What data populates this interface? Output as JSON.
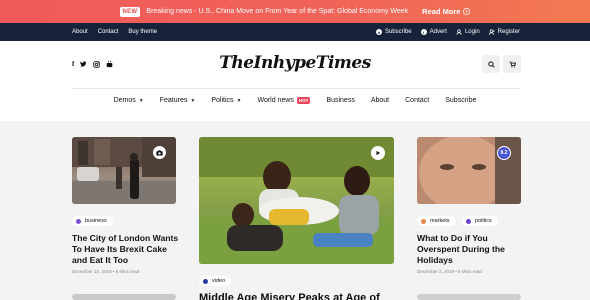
{
  "breaking": {
    "badge": "NEW",
    "text": "Breaking news - U.S., China Move on From Year of the Spat: Global Economy Week",
    "more": "Read More",
    "arrow_icon": "arrow-right-icon"
  },
  "topbar": {
    "links": [
      "About",
      "Contact",
      "Buy theme"
    ],
    "actions": [
      {
        "label": "Subscribe",
        "icon": "bell-icon"
      },
      {
        "label": "Advert",
        "icon": "info-icon"
      },
      {
        "label": "Login",
        "icon": "user-icon"
      },
      {
        "label": "Register",
        "icon": "user-plus-icon"
      }
    ]
  },
  "header": {
    "logo": "TheInhypeTimes",
    "social_icons": [
      "facebook-icon",
      "twitter-icon",
      "instagram-icon",
      "youtube-icon"
    ]
  },
  "nav": {
    "items": [
      {
        "label": "Demos",
        "dropdown": true
      },
      {
        "label": "Features",
        "dropdown": true
      },
      {
        "label": "Politics",
        "dropdown": true
      },
      {
        "label": "World news",
        "badge": "HOT"
      },
      {
        "label": "Business"
      },
      {
        "label": "About"
      },
      {
        "label": "Contact"
      },
      {
        "label": "Subscribe"
      }
    ]
  },
  "articles": {
    "left": {
      "tag": "business",
      "tag_color": "#7b4fd6",
      "title": "The City of London Wants To Have Its Brexit Cake and Eat It Too",
      "date": "December 10, 2019",
      "read": "5 Mins read"
    },
    "center": {
      "tag": "video",
      "tag_color": "#2a3a9a",
      "title": "Middle Age Misery Peaks at Age of"
    },
    "right": {
      "tags": [
        {
          "label": "markets",
          "color": "#e8894a"
        },
        {
          "label": "politics",
          "color": "#6a3fc8"
        }
      ],
      "title": "What to Do if You Overspent During the Holidays",
      "date": "December 2, 2019",
      "read": "5 Mins read",
      "score": "8.2"
    }
  }
}
